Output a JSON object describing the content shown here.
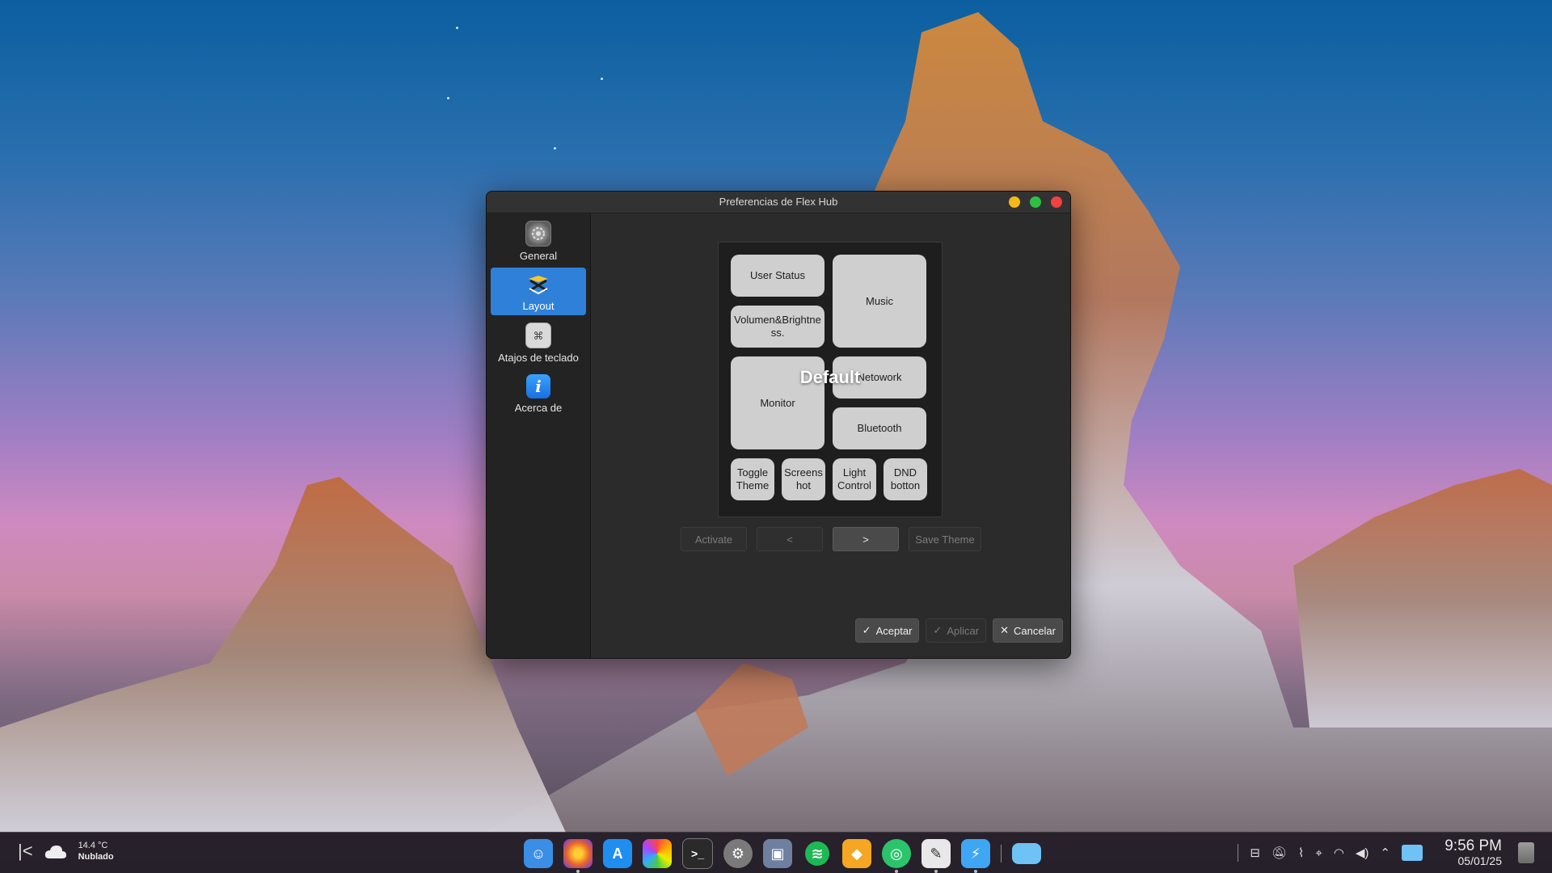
{
  "window": {
    "title": "Preferencias de Flex Hub"
  },
  "sidebar": {
    "items": [
      {
        "label": "General",
        "icon": "settings-icon"
      },
      {
        "label": "Layout",
        "icon": "layout-icon",
        "active": true
      },
      {
        "label": "Atajos de teclado",
        "icon": "keyboard-shortcuts-icon"
      },
      {
        "label": "Acerca de",
        "icon": "info-icon",
        "glyph": "i"
      }
    ]
  },
  "preview": {
    "theme_name": "Default",
    "tiles": {
      "user_status": "User Status",
      "music": "Music",
      "volume": "Volumen&Brightness.",
      "monitor": "Monitor",
      "network": "Netowork",
      "bluetooth": "Bluetooth",
      "toggle_theme": "Toggle Theme",
      "screenshot": "Screenshot",
      "light_control": "Light Control",
      "dnd": "DND botton"
    }
  },
  "nav": {
    "activate": "Activate",
    "prev": "<",
    "next": ">",
    "save_theme": "Save Theme"
  },
  "footer": {
    "accept": "Aceptar",
    "apply": "Aplicar",
    "cancel": "Cancelar"
  },
  "taskbar": {
    "weather": {
      "temp": "14.4 °C",
      "condition": "Nublado"
    },
    "clock": {
      "time": "9:56 PM",
      "date": "05/01/25"
    },
    "apps": [
      {
        "name": "finder-icon",
        "color": "#3a8ee6"
      },
      {
        "name": "firefox-icon",
        "color": "#e8632b"
      },
      {
        "name": "app-store-icon",
        "color": "#1f8ef1"
      },
      {
        "name": "photos-icon",
        "color": "#f0f0f0"
      },
      {
        "name": "terminal-icon",
        "color": "#2a2a2a"
      },
      {
        "name": "system-settings-icon",
        "color": "#7a7a7a"
      },
      {
        "name": "screenshot-tool-icon",
        "color": "#6f7fa0"
      },
      {
        "name": "spotify-icon",
        "color": "#1db954"
      },
      {
        "name": "sketch-icon",
        "color": "#f5a623"
      },
      {
        "name": "green-app-icon",
        "color": "#2cc46b"
      },
      {
        "name": "text-editor-icon",
        "color": "#e8e8e8"
      },
      {
        "name": "flex-hub-icon",
        "color": "#3fa6f4"
      },
      {
        "name": "folder-icon",
        "color": "#6ec2f5"
      }
    ]
  }
}
